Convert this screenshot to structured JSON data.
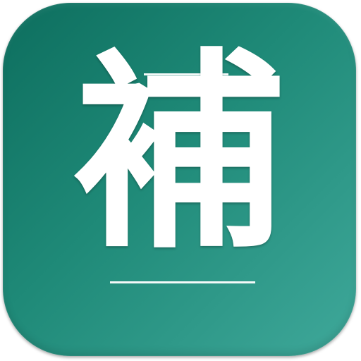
{
  "icon": {
    "glyph": "補",
    "colors": {
      "gradient_start": "#0d6e5e",
      "gradient_mid": "#1f8a78",
      "gradient_end": "#3fa89a",
      "glyph": "#ffffff"
    }
  }
}
